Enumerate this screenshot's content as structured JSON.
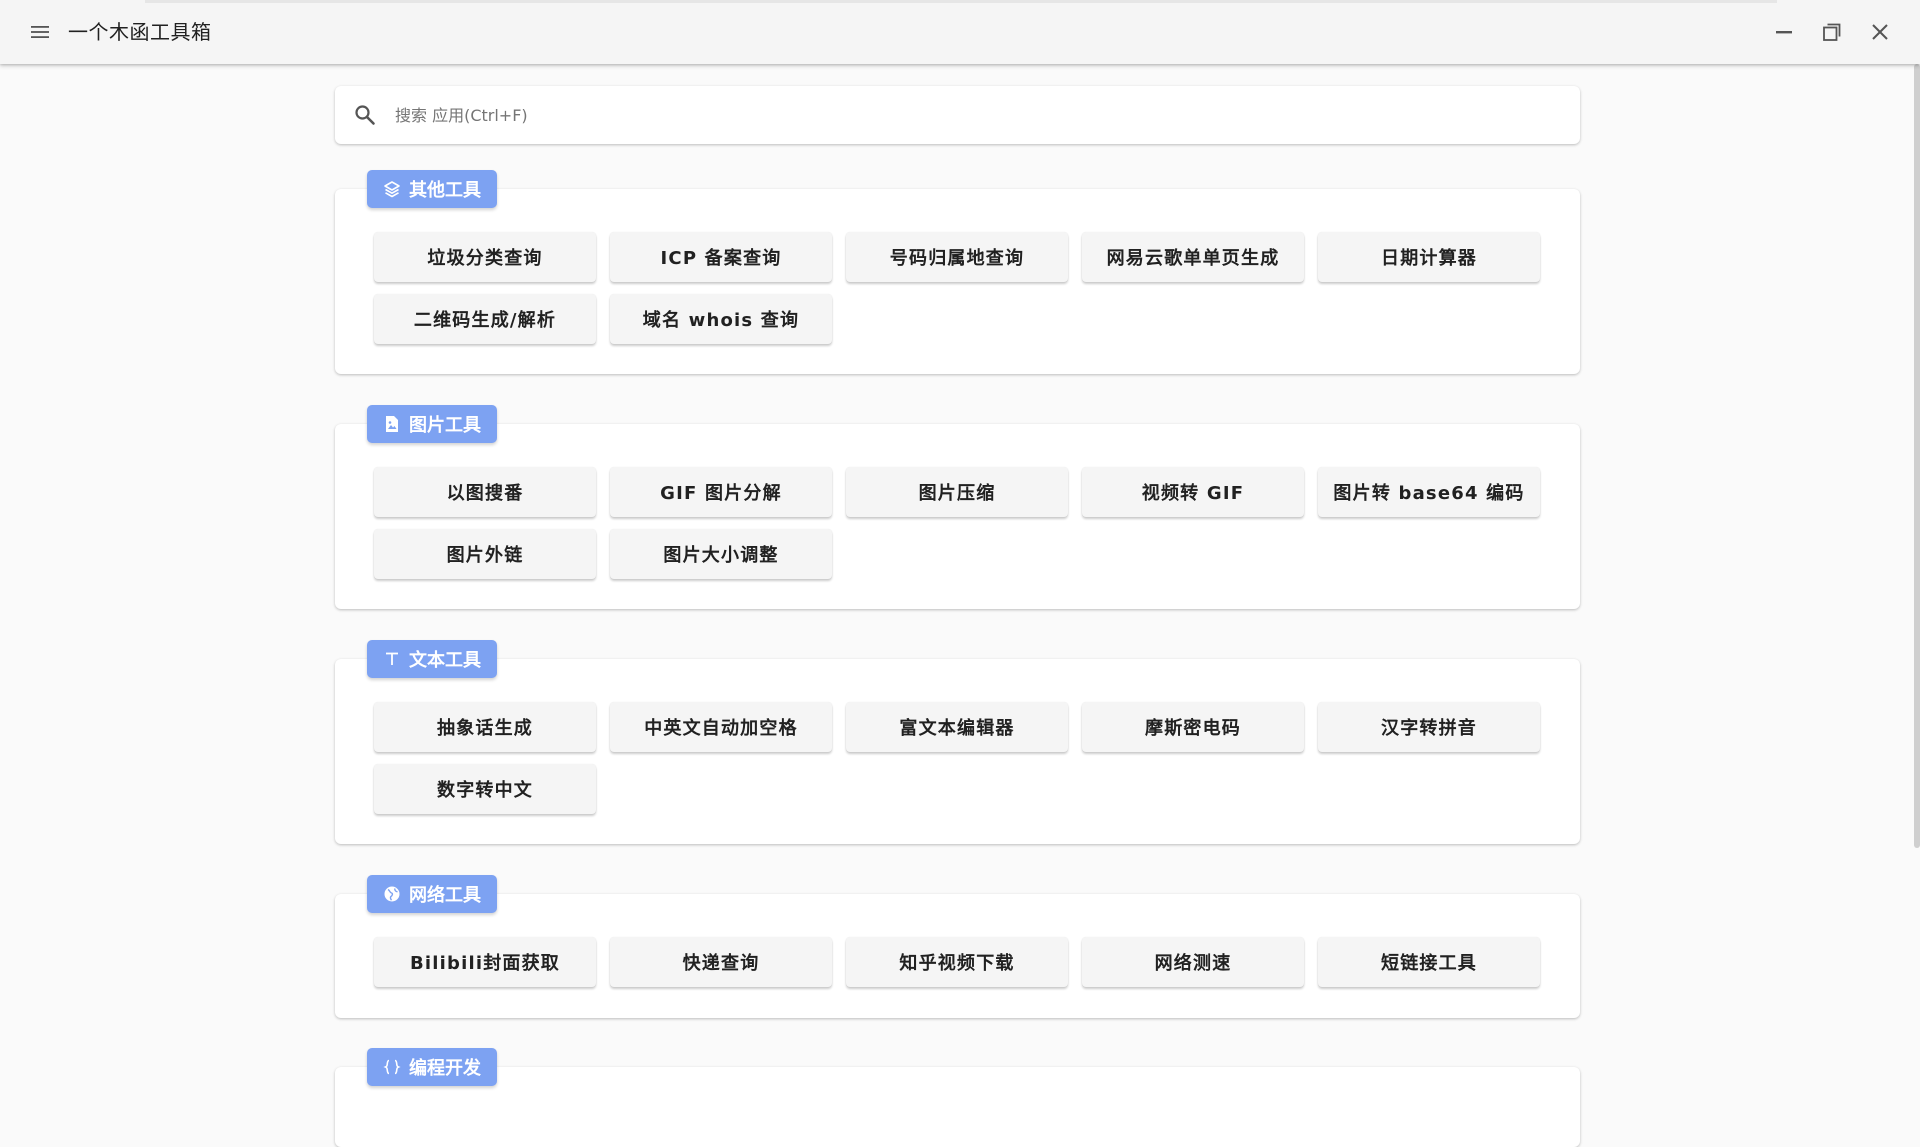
{
  "app": {
    "title": "一个木函工具箱"
  },
  "search": {
    "placeholder": "搜索 应用(Ctrl+F)",
    "value": ""
  },
  "icons": {
    "menu": "hamburger-menu-icon",
    "search": "search-icon",
    "minimize": "window-minimize-icon",
    "maximize": "window-maximize-icon",
    "close": "window-close-icon"
  },
  "colors": {
    "chip": "#7da2f2",
    "titlebar": "#f5f5f5",
    "background": "#fafafa",
    "button": "#f5f5f5"
  },
  "sections": [
    {
      "title": "其他工具",
      "icon": "layers-icon",
      "items": [
        "垃圾分类查询",
        "ICP 备案查询",
        "号码归属地查询",
        "网易云歌单单页生成",
        "日期计算器",
        "二维码生成/解析",
        "域名 whois 查询"
      ]
    },
    {
      "title": "图片工具",
      "icon": "image-file-icon",
      "items": [
        "以图搜番",
        "GIF 图片分解",
        "图片压缩",
        "视频转 GIF",
        "图片转 base64 编码",
        "图片外链",
        "图片大小调整"
      ]
    },
    {
      "title": "文本工具",
      "icon": "text-type-icon",
      "items": [
        "抽象话生成",
        "中英文自动加空格",
        "富文本编辑器",
        "摩斯密电码",
        "汉字转拼音",
        "数字转中文"
      ]
    },
    {
      "title": "网络工具",
      "icon": "globe-icon",
      "items": [
        "Bilibili封面获取",
        "快递查询",
        "知乎视频下载",
        "网络测速",
        "短链接工具"
      ]
    },
    {
      "title": "编程开发",
      "icon": "code-braces-icon",
      "items": []
    }
  ]
}
